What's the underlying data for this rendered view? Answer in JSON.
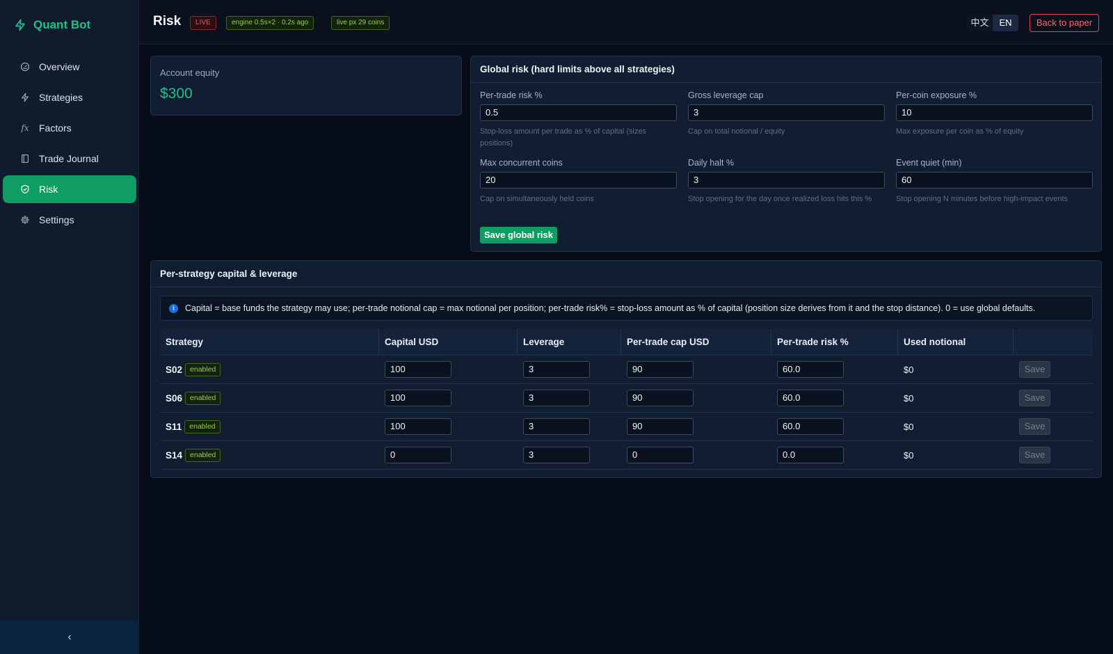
{
  "brand": {
    "name": "Quant Bot"
  },
  "sidebar": {
    "items": [
      {
        "label": "Overview",
        "icon": "gauge-icon"
      },
      {
        "label": "Strategies",
        "icon": "bolt-icon"
      },
      {
        "label": "Factors",
        "icon": "fx-icon",
        "glyph": "fx"
      },
      {
        "label": "Trade Journal",
        "icon": "book-icon"
      },
      {
        "label": "Risk",
        "icon": "shield-icon",
        "active": true
      },
      {
        "label": "Settings",
        "icon": "gear-icon"
      }
    ],
    "collapse_glyph": "‹"
  },
  "header": {
    "title": "Risk",
    "live_badge": "LIVE",
    "engine_badge": "engine 0.5s×2 · 0.2s ago",
    "px_badge": "live px 29 coins",
    "lang_zh": "中文",
    "lang_en": "EN",
    "back_button": "Back to paper"
  },
  "equity": {
    "label": "Account equity",
    "value": "$300"
  },
  "global_risk": {
    "title": "Global risk (hard limits above all strategies)",
    "fields": [
      {
        "label": "Per-trade risk %",
        "value": "0.5",
        "help": "Stop-loss amount per trade as % of capital (sizes positions)"
      },
      {
        "label": "Gross leverage cap",
        "value": "3",
        "help": "Cap on total notional / equity"
      },
      {
        "label": "Per-coin exposure %",
        "value": "10",
        "help": "Max exposure per coin as % of equity"
      },
      {
        "label": "Max concurrent coins",
        "value": "20",
        "help": "Cap on simultaneously held coins"
      },
      {
        "label": "Daily halt %",
        "value": "3",
        "help": "Stop opening for the day once realized loss hits this %"
      },
      {
        "label": "Event quiet (min)",
        "value": "60",
        "help": "Stop opening N minutes before high-impact events"
      }
    ],
    "save_button": "Save global risk"
  },
  "per_strategy": {
    "title": "Per-strategy capital & leverage",
    "info": "Capital = base funds the strategy may use; per-trade notional cap = max notional per position; per-trade risk% = stop-loss amount as % of capital (position size derives from it and the stop distance). 0 = use global defaults.",
    "columns": [
      "Strategy",
      "Capital USD",
      "Leverage",
      "Per-trade cap USD",
      "Per-trade risk %",
      "Used notional",
      ""
    ],
    "rows": [
      {
        "name": "S02",
        "status": "enabled",
        "capital": "100",
        "leverage": "3",
        "cap": "90",
        "risk": "60.0",
        "used": "$0",
        "save": "Save"
      },
      {
        "name": "S06",
        "status": "enabled",
        "capital": "100",
        "leverage": "3",
        "cap": "90",
        "risk": "60.0",
        "used": "$0",
        "save": "Save"
      },
      {
        "name": "S11",
        "status": "enabled",
        "capital": "100",
        "leverage": "3",
        "cap": "90",
        "risk": "60.0",
        "used": "$0",
        "save": "Save"
      },
      {
        "name": "S14",
        "status": "enabled",
        "capital": "0",
        "leverage": "3",
        "cap": "0",
        "risk": "0.0",
        "used": "$0",
        "save": "Save"
      }
    ]
  },
  "colors": {
    "accent": "#0f9d63",
    "accent_text": "#1ec28a",
    "danger": "#e04a54"
  }
}
